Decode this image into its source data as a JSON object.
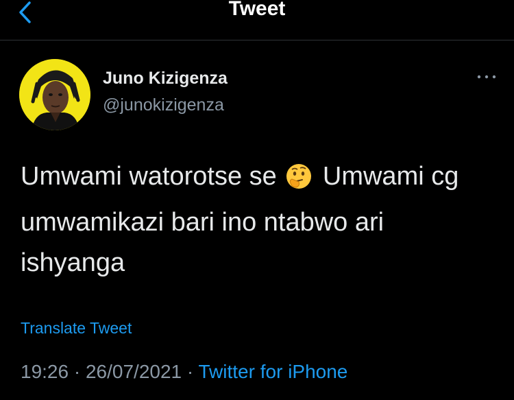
{
  "header": {
    "title": "Tweet",
    "back_icon": "chevron-left-icon"
  },
  "author": {
    "name": "Juno Kizigenza",
    "handle": "@junokizigenza",
    "avatar_bg": "#f2e416",
    "more_icon": "more-horizontal-icon"
  },
  "tweet": {
    "text_part1": "Umwami watorotse se",
    "emoji": "🤔",
    "emoji_name": "thinking-face-emoji",
    "text_part2": "Umwami cg umwamikazi bari ino ntabwo ari ishyanga"
  },
  "translate_label": "Translate Tweet",
  "meta": {
    "time": "19:26",
    "separator1": " · ",
    "date": "26/07/2021",
    "separator2": " · ",
    "source": "Twitter for iPhone"
  },
  "colors": {
    "background": "#000000",
    "text": "#e7e9ea",
    "secondary": "#8b98a5",
    "accent": "#1d9bf0",
    "divider": "#2f3336"
  }
}
